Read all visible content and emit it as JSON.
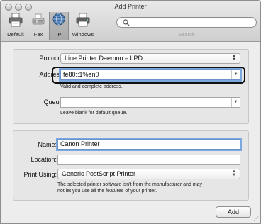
{
  "window": {
    "title": "Add Printer"
  },
  "toolbar": {
    "items": [
      {
        "label": "Default",
        "icon": "printer-icon"
      },
      {
        "label": "Fax",
        "icon": "fax-icon"
      },
      {
        "label": "IP",
        "icon": "globe-icon"
      },
      {
        "label": "Windows",
        "icon": "windows-printer-icon"
      }
    ],
    "active": "IP",
    "search_label": "Search",
    "search_value": ""
  },
  "connection": {
    "protocol_label": "Protocol:",
    "protocol_value": "Line Printer Daemon – LPD",
    "address_label": "Address:",
    "address_value": "fe80::1%en0",
    "address_hint": "Valid and complete address.",
    "queue_label": "Queue:",
    "queue_value": "",
    "queue_hint": "Leave blank for default queue."
  },
  "printer": {
    "name_label": "Name:",
    "name_value": "Canon Printer",
    "location_label": "Location:",
    "location_value": "",
    "print_using_label": "Print Using:",
    "print_using_value": "Generic PostScript Printer",
    "print_using_hint_line1": "The selected printer software isn't from the manufacturer and may",
    "print_using_hint_line2": "not let you use all the features of your printer."
  },
  "actions": {
    "add_label": "Add"
  },
  "colors": {
    "focus": "#7aa8df",
    "window_bg": "#ededed",
    "highlight": "#111111"
  }
}
